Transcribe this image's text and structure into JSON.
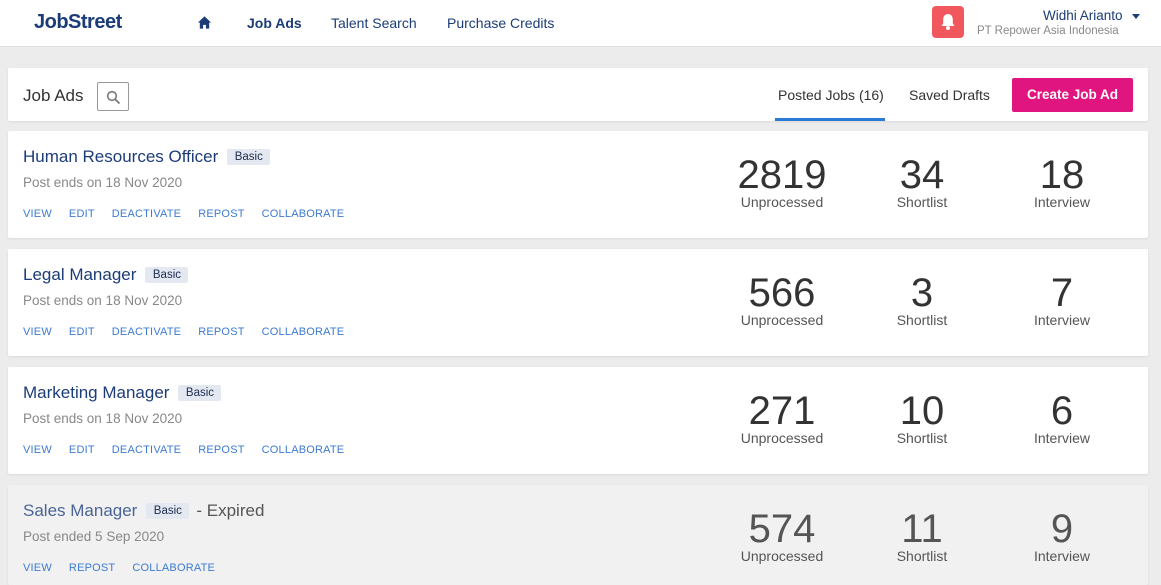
{
  "nav": {
    "logo": "JobStreet",
    "links": [
      "Job Ads",
      "Talent Search",
      "Purchase Credits"
    ],
    "user_name": "Widhi Arianto",
    "company": "PT Repower Asia Indonesia",
    "accent_color": "#1c3c78",
    "bell_color": "#f0585e"
  },
  "header": {
    "title": "Job Ads",
    "tabs": [
      "Posted Jobs (16)",
      "Saved Drafts"
    ],
    "active_tab": "Posted Jobs (16)",
    "create_label": "Create Job Ad",
    "create_color": "#e0157f"
  },
  "jobs": [
    {
      "title": "Human Resources Officer",
      "badge": "Basic",
      "status": "",
      "post_ends": "Post ends on 18 Nov 2020",
      "actions": [
        "VIEW",
        "EDIT",
        "DEACTIVATE",
        "REPOST",
        "COLLABORATE"
      ],
      "unprocessed": "2819",
      "shortlist": "34",
      "interview": "18"
    },
    {
      "title": "Legal Manager",
      "badge": "Basic",
      "status": "",
      "post_ends": "Post ends on 18 Nov 2020",
      "actions": [
        "VIEW",
        "EDIT",
        "DEACTIVATE",
        "REPOST",
        "COLLABORATE"
      ],
      "unprocessed": "566",
      "shortlist": "3",
      "interview": "7"
    },
    {
      "title": "Marketing Manager",
      "badge": "Basic",
      "status": "",
      "post_ends": "Post ends on 18 Nov 2020",
      "actions": [
        "VIEW",
        "EDIT",
        "DEACTIVATE",
        "REPOST",
        "COLLABORATE"
      ],
      "unprocessed": "271",
      "shortlist": "10",
      "interview": "6"
    },
    {
      "title": "Sales Manager",
      "badge": "Basic",
      "status": "- Expired",
      "post_ends": "Post ended 5 Sep 2020",
      "actions": [
        "VIEW",
        "REPOST",
        "COLLABORATE"
      ],
      "unprocessed": "574",
      "shortlist": "11",
      "interview": "9"
    }
  ],
  "stat_labels": {
    "unprocessed": "Unprocessed",
    "shortlist": "Shortlist",
    "interview": "Interview"
  }
}
